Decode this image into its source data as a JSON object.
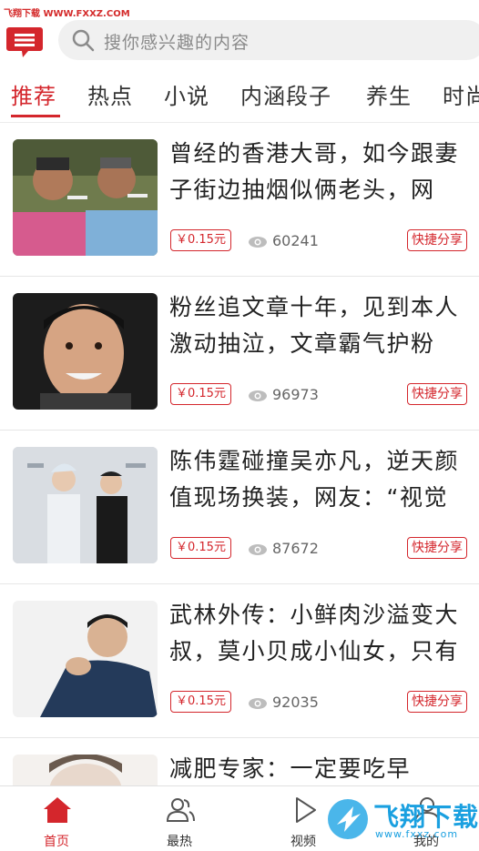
{
  "watermark": {
    "top_left": "飞翔下载 WWW.FXXZ.COM",
    "bottom_right_text": "飞翔下载",
    "bottom_right_url": "www.fxxz.com"
  },
  "search": {
    "placeholder": "搜你感兴趣的内容",
    "icon": "search-icon"
  },
  "header": {
    "message_icon": "message-icon",
    "accent_color": "#d4262c"
  },
  "tabs": [
    {
      "label": "推荐",
      "active": true
    },
    {
      "label": "热点",
      "active": false
    },
    {
      "label": "小说",
      "active": false
    },
    {
      "label": "内涵段子",
      "active": false
    },
    {
      "label": "养生",
      "active": false
    },
    {
      "label": "时尚",
      "active": false
    }
  ],
  "feed": [
    {
      "title": "曾经的香港大哥，如今跟妻子街边抽烟似俩老头，网",
      "price": "￥0.15元",
      "views": "60241",
      "share": "快捷分享"
    },
    {
      "title": "粉丝追文章十年，见到本人激动抽泣，文章霸气护粉",
      "price": "￥0.15元",
      "views": "96973",
      "share": "快捷分享"
    },
    {
      "title": "陈伟霆碰撞吴亦凡，逆天颜值现场换装，网友：“视觉",
      "price": "￥0.15元",
      "views": "87672",
      "share": "快捷分享"
    },
    {
      "title": "武林外传：小鲜肉沙溢变大叔，莫小贝成小仙女，只有",
      "price": "￥0.15元",
      "views": "92035",
      "share": "快捷分享"
    },
    {
      "title": "减肥专家：一定要吃早",
      "price": "",
      "views": "",
      "share": ""
    }
  ],
  "bottom_nav": [
    {
      "label": "首页",
      "icon": "home-icon",
      "active": true
    },
    {
      "label": "最热",
      "icon": "users-icon",
      "active": false
    },
    {
      "label": "视频",
      "icon": "play-icon",
      "active": false
    },
    {
      "label": "我的",
      "icon": "user-icon",
      "active": false
    }
  ]
}
